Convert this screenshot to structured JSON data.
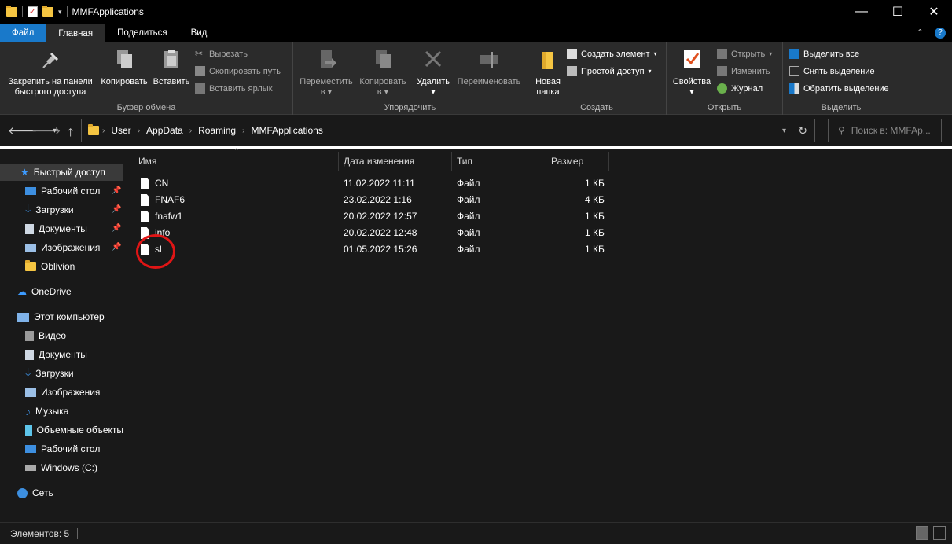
{
  "window": {
    "title": "MMFApplications",
    "buttons": {
      "minimize": "—",
      "maximize": "☐",
      "close": "✕"
    }
  },
  "tabs": {
    "file": "Файл",
    "home": "Главная",
    "share": "Поделиться",
    "view": "Вид"
  },
  "ribbon": {
    "clipboard": {
      "label": "Буфер обмена",
      "pin": "Закрепить на панели быстрого доступа",
      "pin_line1": "Закрепить на панели",
      "pin_line2": "быстрого доступа",
      "copy": "Копировать",
      "paste": "Вставить",
      "cut": "Вырезать",
      "copy_path": "Скопировать путь",
      "paste_shortcut": "Вставить ярлык"
    },
    "organize": {
      "label": "Упорядочить",
      "move_line1": "Переместить",
      "move_line2": "в",
      "copy_line1": "Копировать",
      "copy_line2": "в",
      "delete": "Удалить",
      "rename": "Переименовать"
    },
    "create": {
      "label": "Создать",
      "new_folder_line1": "Новая",
      "new_folder_line2": "папка",
      "new_item": "Создать элемент",
      "easy_access": "Простой доступ"
    },
    "open": {
      "label": "Открыть",
      "properties": "Свойства",
      "open": "Открыть",
      "edit": "Изменить",
      "history": "Журнал"
    },
    "select": {
      "label": "Выделить",
      "select_all": "Выделить все",
      "select_none": "Снять выделение",
      "invert": "Обратить выделение"
    }
  },
  "address": {
    "crumbs": [
      "User",
      "AppData",
      "Roaming",
      "MMFApplications"
    ],
    "search_placeholder": "Поиск в: MMFAp..."
  },
  "sidebar": {
    "quick_access": "Быстрый доступ",
    "quick_items": [
      "Рабочий стол",
      "Загрузки",
      "Документы",
      "Изображения",
      "Oblivion"
    ],
    "onedrive": "OneDrive",
    "this_pc": "Этот компьютер",
    "pc_items": [
      "Видео",
      "Документы",
      "Загрузки",
      "Изображения",
      "Музыка",
      "Объемные объекты",
      "Рабочий стол",
      "Windows (C:)"
    ],
    "network": "Сеть"
  },
  "columns": {
    "name": "Имя",
    "date": "Дата изменения",
    "type": "Тип",
    "size": "Размер"
  },
  "files": [
    {
      "name": "CN",
      "date": "11.02.2022 11:11",
      "type": "Файл",
      "size": "1 КБ"
    },
    {
      "name": "FNAF6",
      "date": "23.02.2022 1:16",
      "type": "Файл",
      "size": "4 КБ"
    },
    {
      "name": "fnafw1",
      "date": "20.02.2022 12:57",
      "type": "Файл",
      "size": "1 КБ"
    },
    {
      "name": "info",
      "date": "20.02.2022 12:48",
      "type": "Файл",
      "size": "1 КБ"
    },
    {
      "name": "sl",
      "date": "01.05.2022 15:26",
      "type": "Файл",
      "size": "1 КБ"
    }
  ],
  "status": {
    "items_count": "Элементов: 5"
  },
  "colors": {
    "accent": "#1979ca",
    "annotation": "#e01515"
  }
}
